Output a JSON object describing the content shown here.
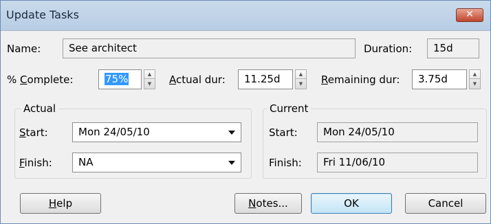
{
  "window": {
    "title": "Update Tasks",
    "close_glyph": "✕"
  },
  "name": {
    "label": "Name:",
    "value": "See architect"
  },
  "duration": {
    "label": "Duration:",
    "value": "15d"
  },
  "percent_complete": {
    "label_prefix": "% ",
    "label_mnemonic": "C",
    "label_rest": "omplete:",
    "value": "75%"
  },
  "actual_dur": {
    "label_mnemonic": "A",
    "label_rest": "ctual dur:",
    "value": "11.25d"
  },
  "remaining_dur": {
    "label_mnemonic": "R",
    "label_rest": "emaining dur:",
    "value": "3.75d"
  },
  "actual_group": {
    "title": "Actual",
    "start": {
      "label_mnemonic": "S",
      "label_rest": "tart:",
      "value": "Mon 24/05/10"
    },
    "finish": {
      "label_mnemonic": "F",
      "label_rest": "inish:",
      "value": "NA"
    }
  },
  "current_group": {
    "title": "Current",
    "start": {
      "label": "Start:",
      "value": "Mon 24/05/10"
    },
    "finish": {
      "label": "Finish:",
      "value": "Fri 11/06/10"
    }
  },
  "buttons": {
    "help": {
      "mnemonic": "H",
      "rest": "elp"
    },
    "notes": {
      "mnemonic": "N",
      "rest": "otes..."
    },
    "ok": "OK",
    "cancel": "Cancel"
  },
  "icons": {
    "spin_up": "▲",
    "spin_down": "▼"
  }
}
